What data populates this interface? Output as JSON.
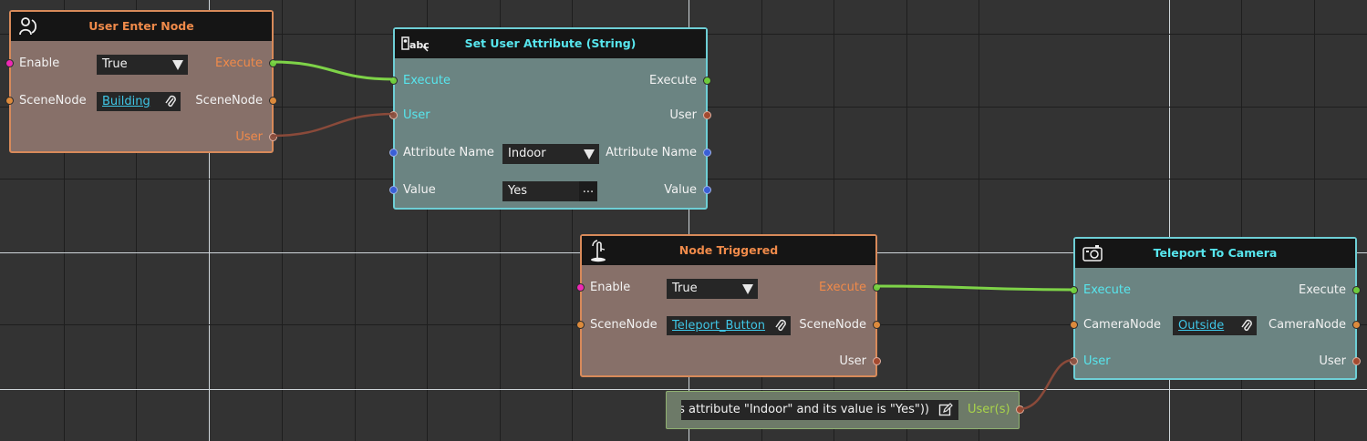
{
  "nodes": {
    "user_enter": {
      "title": "User Enter Node",
      "enable_label": "Enable",
      "enable_value": "True",
      "execute_out": "Execute",
      "scenenode_label": "SceneNode",
      "scenenode_value": "Building",
      "scenenode_out": "SceneNode",
      "user_out": "User"
    },
    "set_attr": {
      "title": "Set User Attribute (String)",
      "execute_in": "Execute",
      "execute_out": "Execute",
      "user_in": "User",
      "user_out": "User",
      "attr_label": "Attribute Name",
      "attr_value": "Indoor",
      "attr_out": "Attribute Name",
      "value_label": "Value",
      "value_value": "Yes",
      "value_button": "...",
      "value_out": "Value"
    },
    "node_triggered": {
      "title": "Node Triggered",
      "enable_label": "Enable",
      "enable_value": "True",
      "execute_out": "Execute",
      "scenenode_label": "SceneNode",
      "scenenode_value": "Teleport_Button",
      "scenenode_out": "SceneNode",
      "user_out": "User"
    },
    "teleport": {
      "title": "Teleport To Camera",
      "execute_in": "Execute",
      "execute_out": "Execute",
      "camera_label": "CameraNode",
      "camera_value": "Outside",
      "camera_out": "CameraNode",
      "user_in": "User",
      "user_out": "User"
    },
    "filter": {
      "expression": "has attribute \"Indoor\" and its value is \"Yes\"))",
      "output": "User(s)"
    }
  },
  "icons": {
    "user_enter": "user-enter-icon",
    "set_attr": "text-attribute-icon",
    "node_triggered": "touch-trigger-icon",
    "teleport": "camera-icon",
    "scene_ref": "paperclip-icon",
    "expr_edit": "edit-icon"
  },
  "colors": {
    "background": "#333333",
    "action_node_border": "#d88a5a",
    "data_node_border": "#6ecfd6",
    "execute_wire": "#7ed348",
    "user_wire": "#8a4a3a",
    "link": "#3fc6e6"
  }
}
